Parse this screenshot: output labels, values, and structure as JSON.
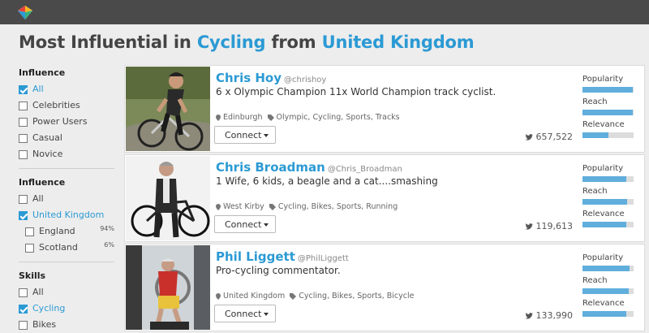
{
  "header": {
    "title_prefix": "Most Influential in",
    "topic": "Cycling",
    "title_mid": "from",
    "location": "United Kingdom"
  },
  "sidebar": {
    "groups": [
      {
        "title": "Influence",
        "options": [
          {
            "label": "All",
            "checked": true
          },
          {
            "label": "Celebrities",
            "checked": false
          },
          {
            "label": "Power Users",
            "checked": false
          },
          {
            "label": "Casual",
            "checked": false
          },
          {
            "label": "Novice",
            "checked": false
          }
        ]
      },
      {
        "title": "Influence",
        "options": [
          {
            "label": "All",
            "checked": false
          },
          {
            "label": "United Kingdom",
            "checked": true
          },
          {
            "label": "England",
            "checked": false,
            "pct": "94%"
          },
          {
            "label": "Scotland",
            "checked": false,
            "pct": "6%"
          }
        ]
      },
      {
        "title": "Skills",
        "options": [
          {
            "label": "All",
            "checked": false
          },
          {
            "label": "Cycling",
            "checked": true
          },
          {
            "label": "Bikes",
            "checked": false
          }
        ]
      }
    ]
  },
  "metric_labels": {
    "popularity": "Popularity",
    "reach": "Reach",
    "relevance": "Relevance"
  },
  "connect_label": "Connect",
  "people": [
    {
      "name": "Chris Hoy",
      "handle": "@chrishoy",
      "bio": "6 x Olympic Champion 11x World Champion track cyclist.",
      "location": "Edinburgh",
      "tags": "Olympic, Cycling, Sports, Tracks",
      "followers": "657,522",
      "popularity": 0.98,
      "reach": 0.98,
      "relevance": 0.5
    },
    {
      "name": "Chris Broadman",
      "handle": "@Chris_Broadman",
      "bio": "1 Wife, 6 kids, a beagle and a cat....smashing",
      "location": "West Kirby",
      "tags": "Cycling, Bikes, Sports, Running",
      "followers": "119,613",
      "popularity": 0.85,
      "reach": 0.87,
      "relevance": 0.86
    },
    {
      "name": "Phil Liggett",
      "handle": "@PhilLiggett",
      "bio": "Pro-cycling commentator.",
      "location": "United Kingdom",
      "tags": "Cycling, Bikes, Sports, Bicycle",
      "followers": "133,990",
      "popularity": 0.92,
      "reach": 0.9,
      "relevance": 0.86
    }
  ],
  "colors": {
    "accent": "#2b9ad4",
    "bar_fill": "#5faedc",
    "topbar": "#4a4a4a"
  }
}
